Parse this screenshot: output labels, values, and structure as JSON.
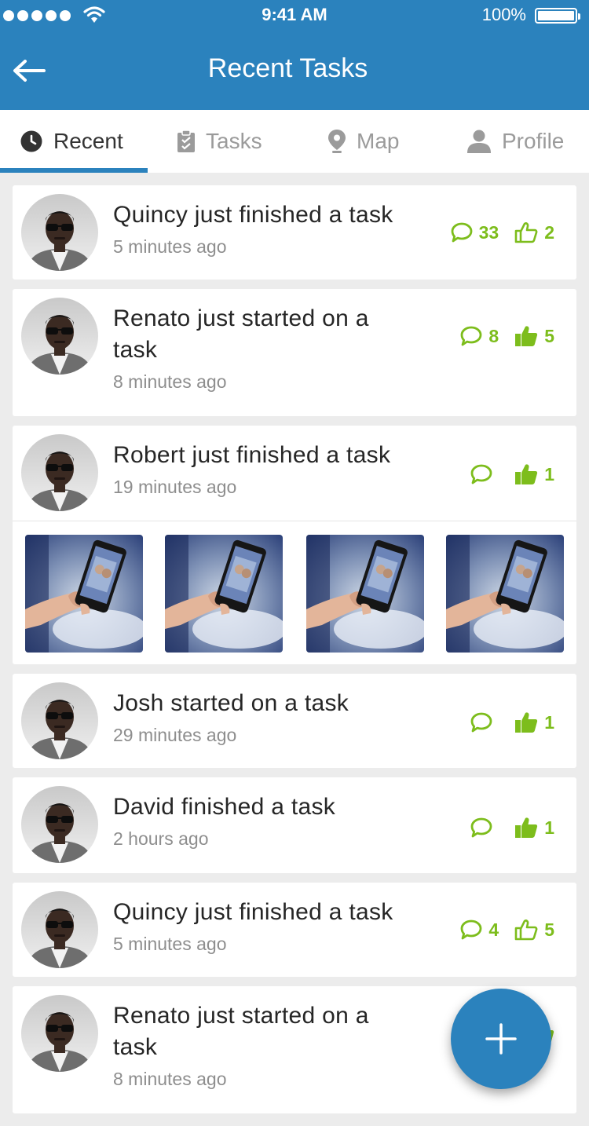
{
  "status_bar": {
    "time": "9:41 AM",
    "battery": "100%"
  },
  "header": {
    "title": "Recent Tasks"
  },
  "tabs": [
    {
      "label": "Recent",
      "icon": "clock-icon"
    },
    {
      "label": "Tasks",
      "icon": "clipboard-check-icon"
    },
    {
      "label": "Map",
      "icon": "location-pin-icon"
    },
    {
      "label": "Profile",
      "icon": "user-icon"
    }
  ],
  "feed": [
    {
      "message": "Quincy just finished a task",
      "time": "5 minutes ago",
      "comments": "33",
      "likes": "2"
    },
    {
      "message": "Renato just started on a task",
      "time": "8 minutes ago",
      "comments": "8",
      "likes": "5"
    },
    {
      "message": "Robert just finished a task",
      "time": "19 minutes ago",
      "comments": "",
      "likes": "1"
    },
    {
      "message": "Josh started on a task",
      "time": "29 minutes ago",
      "comments": "",
      "likes": "1"
    },
    {
      "message": "David finished a task",
      "time": "2 hours ago",
      "comments": "",
      "likes": "1"
    },
    {
      "message": "Quincy just finished a task",
      "time": "5 minutes ago",
      "comments": "4",
      "likes": "5"
    },
    {
      "message": "Renato just started on a task",
      "time": "8 minutes ago",
      "comments": "",
      "likes": ""
    }
  ],
  "colors": {
    "primary": "#2b82bd",
    "accent_green": "#7dbd1c",
    "background": "#ececec"
  }
}
